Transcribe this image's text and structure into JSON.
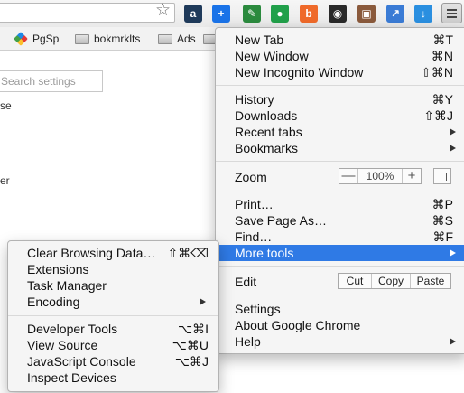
{
  "toolbar": {
    "extensions": [
      {
        "name": "amazon-assistant-icon",
        "glyph": "a",
        "color": "#1f3a5a"
      },
      {
        "name": "plus-extension-icon",
        "glyph": "+",
        "color": "#1a73e8"
      },
      {
        "name": "eyedropper-icon",
        "glyph": "✎",
        "color": "#2b8a3e"
      },
      {
        "name": "green-balloon-icon",
        "glyph": "●",
        "color": "#21a04a"
      },
      {
        "name": "bitly-icon",
        "glyph": "b",
        "color": "#ef6a2a"
      },
      {
        "name": "aperture-icon",
        "glyph": "◉",
        "color": "#2a2a2a"
      },
      {
        "name": "instagram-icon",
        "glyph": "▣",
        "color": "#8a5a3c"
      },
      {
        "name": "chart-extension-icon",
        "glyph": "↗",
        "color": "#3a7bd5"
      },
      {
        "name": "download-extension-icon",
        "glyph": "↓",
        "color": "#2a8fe0"
      }
    ]
  },
  "bookmarks": [
    {
      "label": "PgSp",
      "icon": "google-icon"
    },
    {
      "label": "bokmrklts",
      "icon": "folder-icon"
    },
    {
      "label": "Ads",
      "icon": "folder-icon"
    },
    {
      "label": "",
      "icon": "folder-icon"
    }
  ],
  "settings_page": {
    "search_placeholder": "Search settings",
    "fragments": [
      "se",
      "er"
    ]
  },
  "main_menu": {
    "new_tab": {
      "label": "New Tab",
      "shortcut": "⌘T"
    },
    "new_window": {
      "label": "New Window",
      "shortcut": "⌘N"
    },
    "new_incognito": {
      "label": "New Incognito Window",
      "shortcut": "⇧⌘N"
    },
    "history": {
      "label": "History",
      "shortcut": "⌘Y"
    },
    "downloads": {
      "label": "Downloads",
      "shortcut": "⇧⌘J"
    },
    "recent_tabs": {
      "label": "Recent tabs"
    },
    "bookmarks": {
      "label": "Bookmarks"
    },
    "zoom": {
      "label": "Zoom",
      "minus": "—",
      "value": "100%",
      "plus": "+"
    },
    "print": {
      "label": "Print…",
      "shortcut": "⌘P"
    },
    "save_page": {
      "label": "Save Page As…",
      "shortcut": "⌘S"
    },
    "find": {
      "label": "Find…",
      "shortcut": "⌘F"
    },
    "more_tools": {
      "label": "More tools"
    },
    "edit": {
      "label": "Edit",
      "cut": "Cut",
      "copy": "Copy",
      "paste": "Paste"
    },
    "settings": {
      "label": "Settings"
    },
    "about": {
      "label": "About Google Chrome"
    },
    "help": {
      "label": "Help"
    }
  },
  "sub_menu": {
    "clear_browsing": {
      "label": "Clear Browsing Data…",
      "shortcut": "⇧⌘⌫"
    },
    "extensions": {
      "label": "Extensions"
    },
    "task_manager": {
      "label": "Task Manager"
    },
    "encoding": {
      "label": "Encoding"
    },
    "developer_tools": {
      "label": "Developer Tools",
      "shortcut": "⌥⌘I"
    },
    "view_source": {
      "label": "View Source",
      "shortcut": "⌥⌘U"
    },
    "js_console": {
      "label": "JavaScript Console",
      "shortcut": "⌥⌘J"
    },
    "inspect_devices": {
      "label": "Inspect Devices"
    }
  },
  "colors": {
    "highlight": "#2f7ae5",
    "menu_bg": "#f5f5f5"
  }
}
